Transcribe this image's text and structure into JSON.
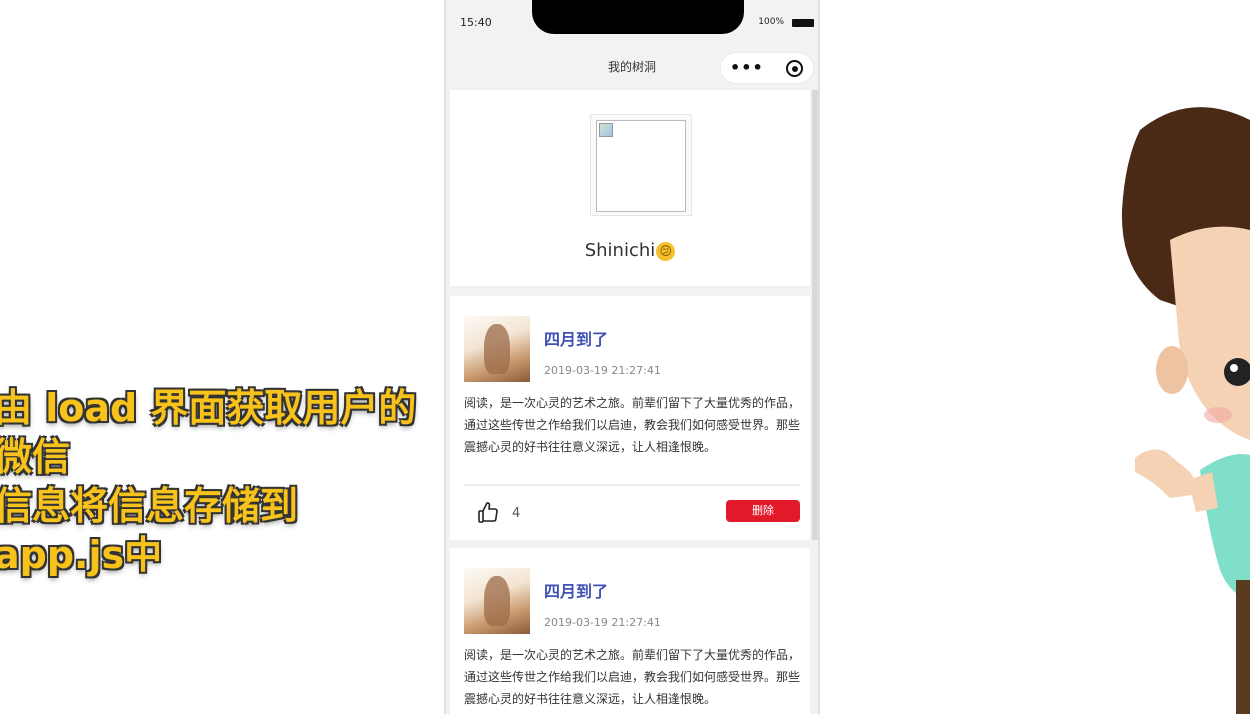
{
  "caption": {
    "lines": [
      "由 load 界面获取用户的",
      "微信",
      "信息将信息存储到",
      "app.js中"
    ]
  },
  "status_bar": {
    "time": "15:40",
    "battery": "100%"
  },
  "navbar": {
    "title": "我的树洞",
    "more_icon": "more-dots-icon",
    "close_icon": "target-icon"
  },
  "profile": {
    "username": "Shinichi",
    "emoji": "😕"
  },
  "posts": [
    {
      "title": "四月到了",
      "date": "2019-03-19 21:27:41",
      "body": "阅读，是一次心灵的艺术之旅。前辈们留下了大量优秀的作品，通过这些传世之作给我们以启迪，教会我们如何感受世界。那些震撼心灵的好书往往意义深远，让人相逢恨晚。",
      "likes": "4",
      "delete_label": "删除"
    },
    {
      "title": "四月到了",
      "date": "2019-03-19 21:27:41",
      "body": "阅读，是一次心灵的艺术之旅。前辈们留下了大量优秀的作品，通过这些传世之作给我们以启迪，教会我们如何感受世界。那些震撼心灵的好书往往意义深远，让人相逢恨晚。"
    }
  ],
  "colors": {
    "caption": "#f7c21a",
    "title_link": "#3f51b5",
    "delete_button": "#e1192a"
  }
}
